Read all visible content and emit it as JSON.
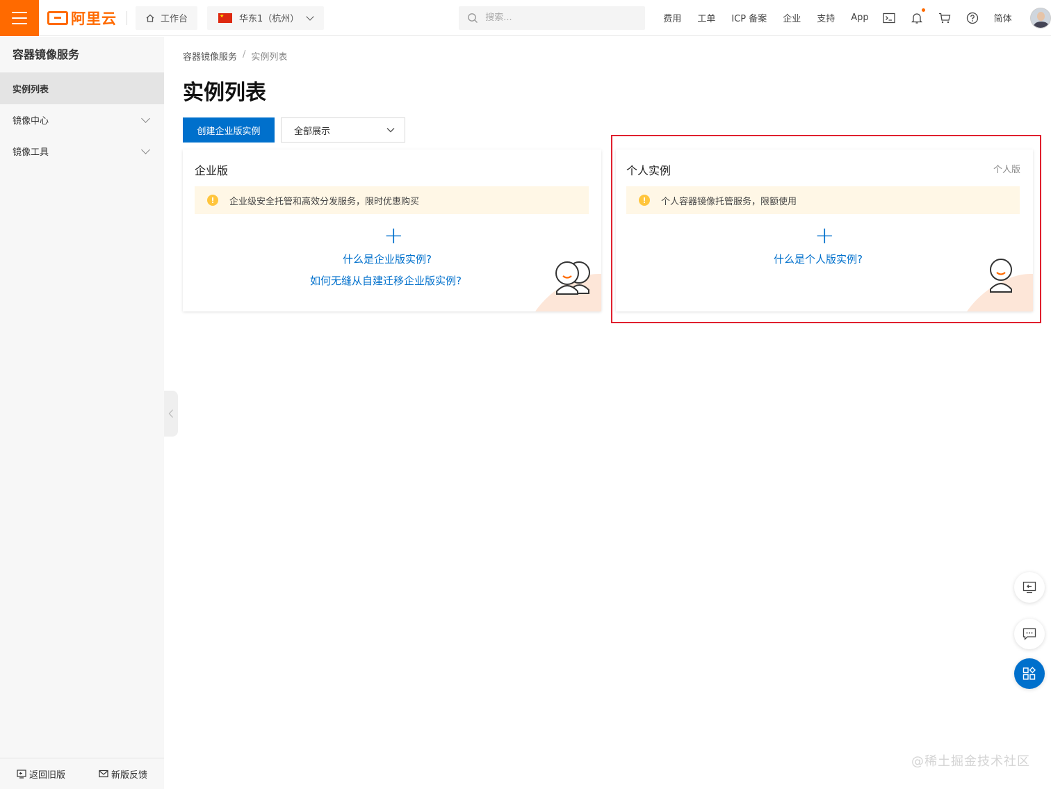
{
  "topbar": {
    "logo_text": "阿里云",
    "workbench": "工作台",
    "region": "华东1（杭州）",
    "search_placeholder": "搜索...",
    "links": [
      "费用",
      "工单",
      "ICP 备案",
      "企业",
      "支持",
      "App"
    ],
    "language": "简体",
    "brand_color": "#ff6a00"
  },
  "sidebar": {
    "title": "容器镜像服务",
    "items": [
      {
        "label": "实例列表"
      },
      {
        "label": "镜像中心"
      },
      {
        "label": "镜像工具"
      }
    ],
    "bottom": {
      "back": "返回旧版",
      "feedback": "新版反馈"
    }
  },
  "main": {
    "breadcrumb": [
      "容器镜像服务",
      "实例列表"
    ],
    "breadcrumb_sep": "/",
    "title": "实例列表",
    "create_button": "创建企业版实例",
    "filter_value": "全部展示",
    "accent_color": "#0070cc"
  },
  "cards": {
    "enterprise": {
      "title": "企业版",
      "notice": "企业级安全托管和高效分发服务，限时优惠购买",
      "link1": "什么是企业版实例?",
      "link2": "如何无缝从自建迁移企业版实例?"
    },
    "personal": {
      "title": "个人实例",
      "tag": "个人版",
      "notice": "个人容器镜像托管服务，限额使用",
      "link1": "什么是个人版实例?"
    }
  },
  "watermark": "@稀土掘金技术社区",
  "highlight_color": "#e0202e"
}
